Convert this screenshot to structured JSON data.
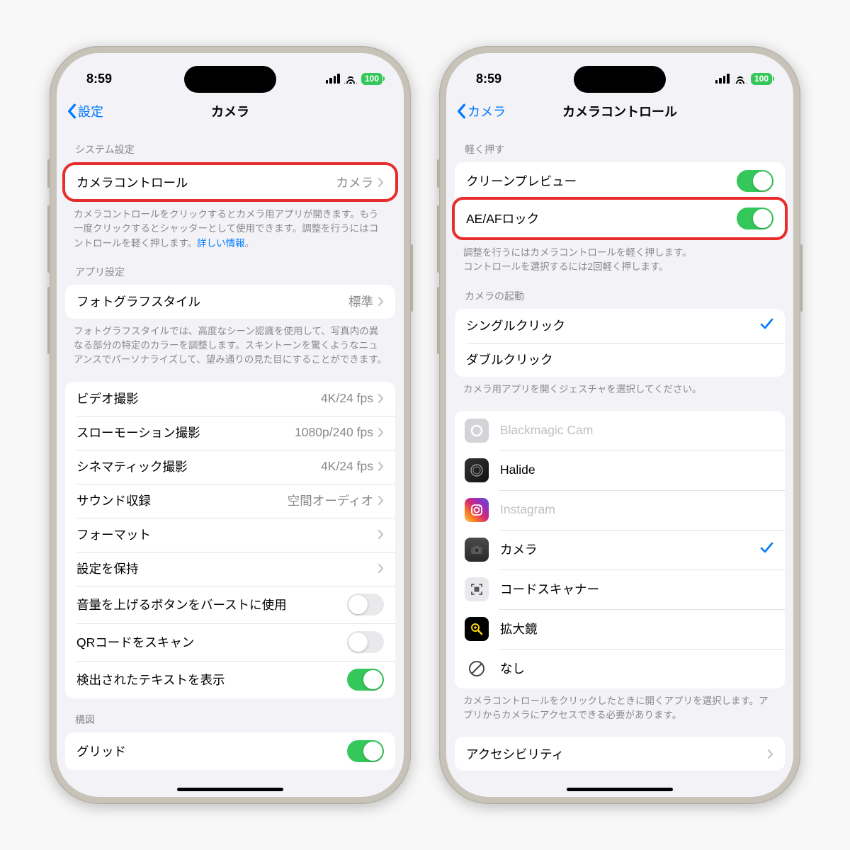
{
  "status": {
    "time": "8:59",
    "battery": "100"
  },
  "left": {
    "back": "設定",
    "title": "カメラ",
    "s1_header": "システム設定",
    "camera_control": {
      "label": "カメラコントロール",
      "value": "カメラ"
    },
    "s1_footer_a": "カメラコントロールをクリックするとカメラ用アプリが開きます。もう一度クリックするとシャッターとして使用できます。調整を行うにはコントロールを軽く押します。",
    "s1_footer_link": "詳しい情報",
    "s1_footer_b": "。",
    "s2_header": "アプリ設定",
    "photo_style": {
      "label": "フォトグラフスタイル",
      "value": "標準"
    },
    "s2_footer": "フォトグラフスタイルでは、高度なシーン認識を使用して、写真内の異なる部分の特定のカラーを調整します。スキントーンを驚くようなニュアンスでパーソナライズして、望み通りの見た目にすることができます。",
    "rows": {
      "video": {
        "label": "ビデオ撮影",
        "value": "4K/24 fps"
      },
      "slomo": {
        "label": "スローモーション撮影",
        "value": "1080p/240 fps"
      },
      "cine": {
        "label": "シネマティック撮影",
        "value": "4K/24 fps"
      },
      "sound": {
        "label": "サウンド収録",
        "value": "空間オーディオ"
      },
      "format": {
        "label": "フォーマット"
      },
      "preserve": {
        "label": "設定を保持"
      },
      "volume": {
        "label": "音量を上げるボタンをバーストに使用"
      },
      "qr": {
        "label": "QRコードをスキャン"
      },
      "text": {
        "label": "検出されたテキストを表示"
      }
    },
    "s3_header": "構図",
    "grid_label": "グリッド"
  },
  "right": {
    "back": "カメラ",
    "title": "カメラコントロール",
    "s1_header": "軽く押す",
    "clean_preview": "クリーンプレビュー",
    "aeaf_lock": "AE/AFロック",
    "s1_footer": "調整を行うにはカメラコントロールを軽く押します。\nコントロールを選択するには2回軽く押します。",
    "s2_header": "カメラの起動",
    "single": "シングルクリック",
    "double": "ダブルクリック",
    "s2_footer": "カメラ用アプリを開くジェスチャを選択してください。",
    "apps": {
      "bmagic": "Blackmagic Cam",
      "halide": "Halide",
      "insta": "Instagram",
      "camera": "カメラ",
      "qr": "コードスキャナー",
      "mag": "拡大鏡",
      "none": "なし"
    },
    "s3_footer": "カメラコントロールをクリックしたときに開くアプリを選択します。アプリからカメラにアクセスできる必要があります。",
    "accessibility": "アクセシビリティ"
  }
}
